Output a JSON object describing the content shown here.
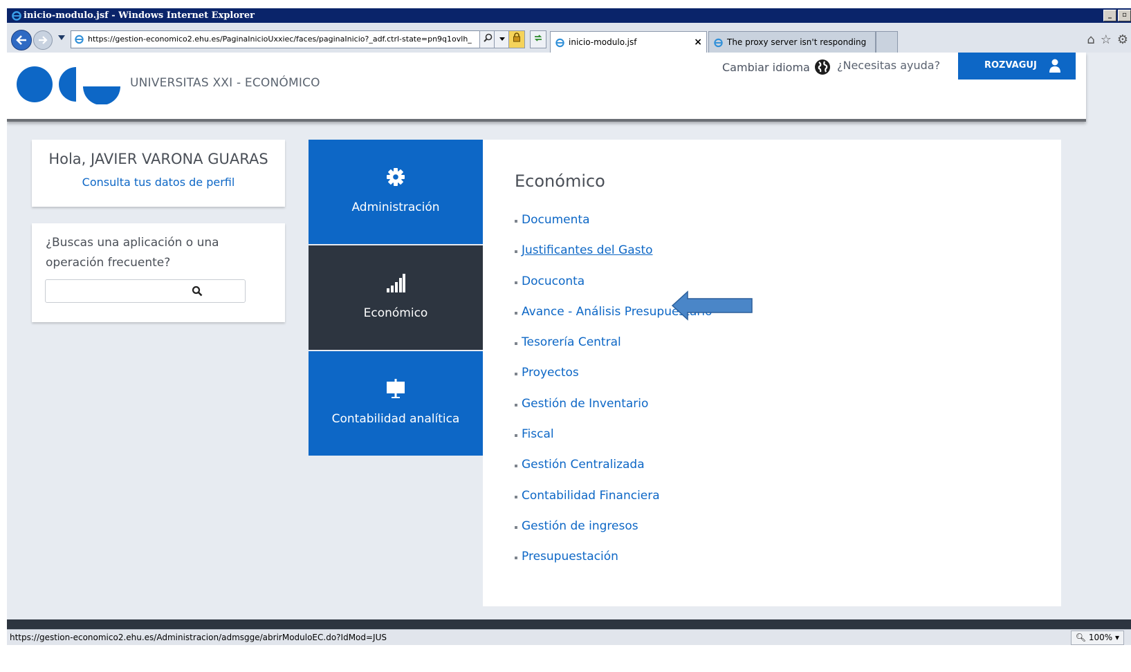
{
  "window": {
    "title": "inicio-modulo.jsf - Windows Internet Explorer",
    "controls": {
      "minimize": "_",
      "restore": "▫"
    }
  },
  "browser": {
    "address": "https://gestion-economico2.ehu.es/PaginaInicioUxxiec/faces/paginaInicio?_adf.ctrl-state=pn9q1ovlh_",
    "tabs": [
      {
        "label": "inicio-modulo.jsf",
        "close": "×"
      },
      {
        "label": "The proxy server isn't responding"
      }
    ],
    "status_url": "https://gestion-economico2.ehu.es/Administracion/admsgge/abrirModuloEC.do?IdMod=JUS",
    "zoom": "100%"
  },
  "header": {
    "brand": "UNIVERSITAS XXI - ECONÓMICO",
    "change_language": "Cambiar idioma",
    "help": "¿Necesitas ayuda?",
    "user": "ROZVAGUJ"
  },
  "profile": {
    "greeting": "Hola, JAVIER VARONA GUARAS",
    "profile_link": "Consulta tus datos de perfil"
  },
  "search": {
    "question": "¿Buscas una aplicación o una operación frecuente?",
    "value": ""
  },
  "tiles": [
    {
      "label": "Administración"
    },
    {
      "label": "Económico"
    },
    {
      "label": "Contabilidad analítica"
    }
  ],
  "panel": {
    "title": "Económico",
    "items": [
      "Documenta",
      "Justificantes del Gasto",
      "Docuconta",
      "Avance - Análisis Presupuestario",
      "Tesorería Central",
      "Proyectos",
      "Gestión de Inventario",
      "Fiscal",
      "Gestión Centralizada",
      "Contabilidad Financiera",
      "Gestión de ingresos",
      "Presupuestación"
    ]
  },
  "colors": {
    "primary_blue": "#0d67c6",
    "dark_tile": "#2d3540",
    "arrow": "#4a86c8"
  }
}
